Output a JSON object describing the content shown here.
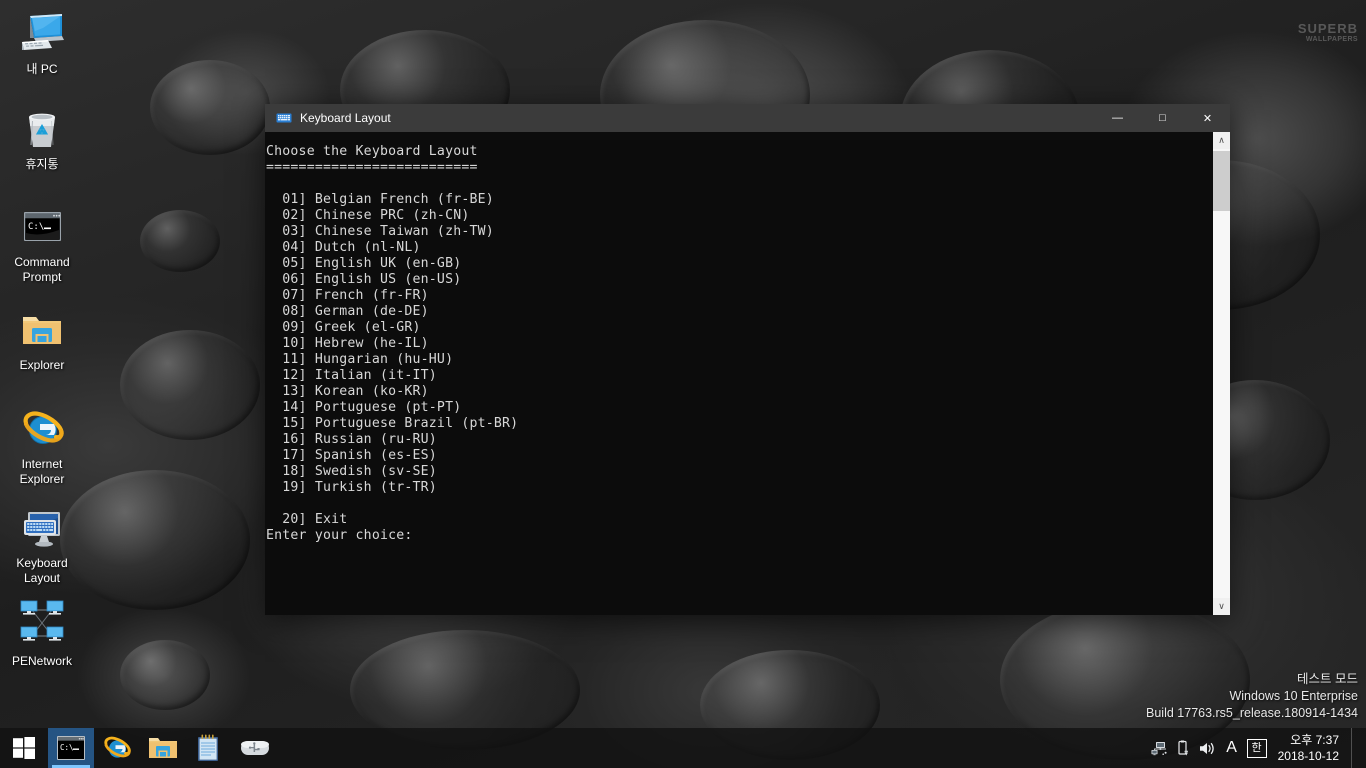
{
  "wallpaper": {
    "watermark_line1": "SUPERB",
    "watermark_line2": "WALLPAPERS"
  },
  "desktop_icons": [
    {
      "label": "내 PC",
      "icon": "my-computer-icon"
    },
    {
      "label": "휴지통",
      "icon": "recycle-bin-icon"
    },
    {
      "label": "Command\nPrompt",
      "icon": "command-prompt-icon"
    },
    {
      "label": "Explorer",
      "icon": "folder-icon"
    },
    {
      "label": "Internet\nExplorer",
      "icon": "internet-explorer-icon"
    },
    {
      "label": "Keyboard\nLayout",
      "icon": "keyboard-monitor-icon"
    },
    {
      "label": "PENetwork",
      "icon": "network-icon"
    }
  ],
  "window": {
    "title": "Keyboard Layout",
    "title_icon": "keyboard-icon",
    "minimize_label": "—",
    "maximize_label": "□",
    "close_label": "✕",
    "console": {
      "heading": "Choose the Keyboard Layout",
      "divider": "==========================",
      "items": [
        "01] Belgian French (fr-BE)",
        "02] Chinese PRC (zh-CN)",
        "03] Chinese Taiwan (zh-TW)",
        "04] Dutch (nl-NL)",
        "05] English UK (en-GB)",
        "06] English US (en-US)",
        "07] French (fr-FR)",
        "08] German (de-DE)",
        "09] Greek (el-GR)",
        "10] Hebrew (he-IL)",
        "11] Hungarian (hu-HU)",
        "12] Italian (it-IT)",
        "13] Korean (ko-KR)",
        "14] Portuguese (pt-PT)",
        "15] Portuguese Brazil (pt-BR)",
        "16] Russian (ru-RU)",
        "17] Spanish (es-ES)",
        "18] Swedish (sv-SE)",
        "19] Turkish (tr-TR)"
      ],
      "exit_item": "20] Exit",
      "prompt": "Enter your choice:",
      "text_color": "#d8d8d8",
      "background_color": "#0c0c0c"
    },
    "scrollbar": {
      "up_arrow": "∧",
      "down_arrow": "∨"
    }
  },
  "taskbar": {
    "start_label": "start-button",
    "items": [
      {
        "name": "taskbar-command-prompt",
        "icon": "command-prompt-icon",
        "active": true
      },
      {
        "name": "taskbar-internet-explorer",
        "icon": "internet-explorer-icon",
        "active": false
      },
      {
        "name": "taskbar-file-explorer",
        "icon": "folder-icon",
        "active": false
      },
      {
        "name": "taskbar-notepad",
        "icon": "notepad-icon",
        "active": false
      },
      {
        "name": "taskbar-usb-drive",
        "icon": "usb-drive-icon",
        "active": false
      }
    ],
    "tray": {
      "network_icon": "network-icon",
      "usb_eject_icon": "usb-eject-icon",
      "volume_icon": "volume-icon",
      "language_icon": "A",
      "ime_badge": "한"
    },
    "clock": {
      "time": "오후 7:37",
      "date": "2018-10-12"
    }
  },
  "test_mode": {
    "line1": "테스트 모드",
    "line2": "Windows 10 Enterprise",
    "line3": "Build 17763.rs5_release.180914-1434"
  }
}
